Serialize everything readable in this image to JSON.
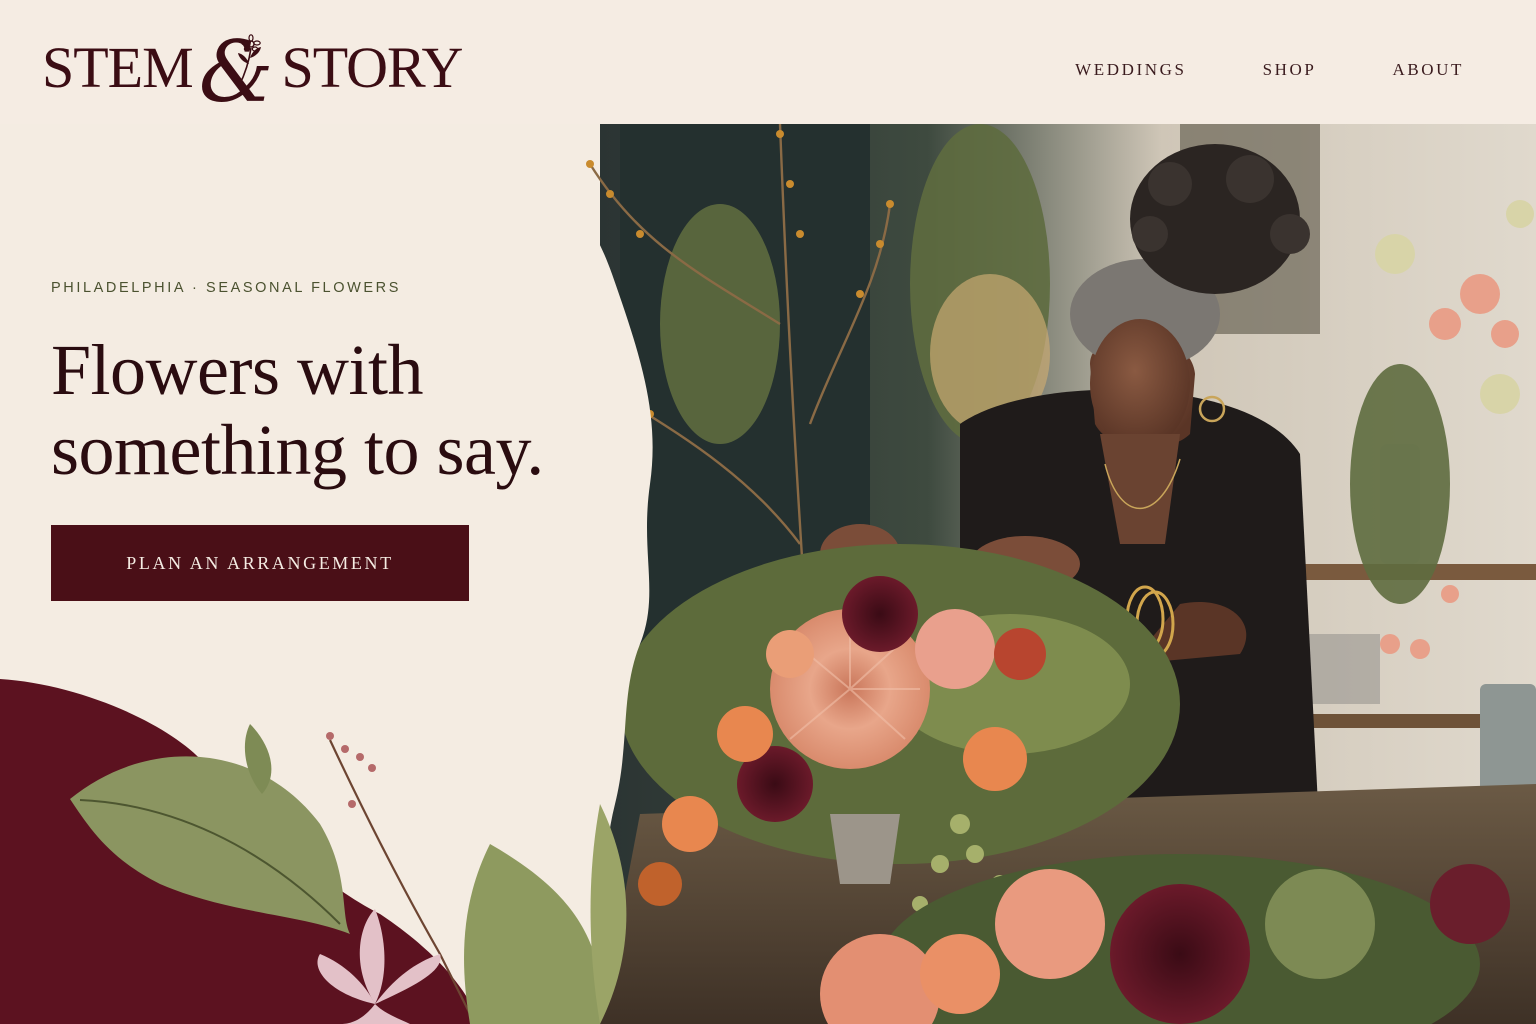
{
  "brand": {
    "name_left": "STEM",
    "ampersand": "&",
    "name_right": "STORY"
  },
  "nav": {
    "items": [
      "WEDDINGS",
      "SHOP",
      "ABOUT"
    ]
  },
  "hero": {
    "eyebrow": "PHILADELPHIA · SEASONAL FLOWERS",
    "headline_line1": "Flowers with",
    "headline_line2": "something to say.",
    "cta_label": "PLAN AN ARRANGEMENT"
  },
  "colors": {
    "background": "#f5ece3",
    "burgundy": "#4a0f17",
    "headline": "#2a0c10",
    "eyebrow": "#4b5230"
  }
}
